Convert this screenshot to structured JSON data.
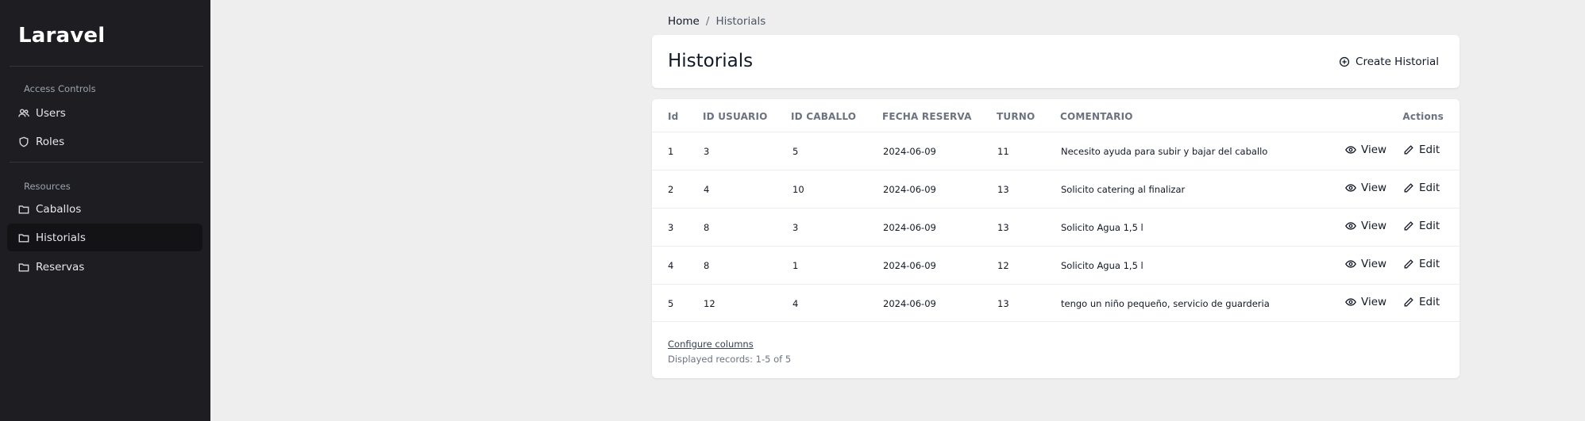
{
  "app": {
    "brand": "Laravel"
  },
  "sidebar": {
    "sections": [
      {
        "label": "Access Controls",
        "items": [
          {
            "label": "Users",
            "icon": "users-icon"
          },
          {
            "label": "Roles",
            "icon": "shield-icon"
          }
        ]
      },
      {
        "label": "Resources",
        "items": [
          {
            "label": "Caballos",
            "icon": "folder-icon"
          },
          {
            "label": "Historials",
            "icon": "folder-icon",
            "active": true
          },
          {
            "label": "Reservas",
            "icon": "folder-icon"
          }
        ]
      }
    ]
  },
  "breadcrumb": {
    "home": "Home",
    "separator": "/",
    "current": "Historials"
  },
  "header": {
    "title": "Historials",
    "create_label": "Create Historial"
  },
  "table": {
    "columns": [
      "Id",
      "ID USUARIO",
      "ID CABALLO",
      "FECHA RESERVA",
      "TURNO",
      "COMENTARIO",
      "Actions"
    ],
    "rows": [
      [
        "1",
        "3",
        "5",
        "2024-06-09",
        "11",
        "Necesito ayuda para subir y bajar del caballo"
      ],
      [
        "2",
        "4",
        "10",
        "2024-06-09",
        "13",
        "Solicito catering al finalizar"
      ],
      [
        "3",
        "8",
        "3",
        "2024-06-09",
        "13",
        "Solicito Agua 1,5 l"
      ],
      [
        "4",
        "8",
        "1",
        "2024-06-09",
        "12",
        "Solicito Agua 1,5 l"
      ],
      [
        "5",
        "12",
        "4",
        "2024-06-09",
        "13",
        "tengo un niño pequeño, servicio de guarderia"
      ]
    ],
    "view_label": "View",
    "edit_label": "Edit"
  },
  "footer": {
    "configure": "Configure columns",
    "displayed": "Displayed records: 1-5 of 5"
  },
  "colors": {
    "sidebar_bg": "#1e1e22",
    "active_item_bg": "#131316",
    "page_bg": "#eeeeef"
  }
}
